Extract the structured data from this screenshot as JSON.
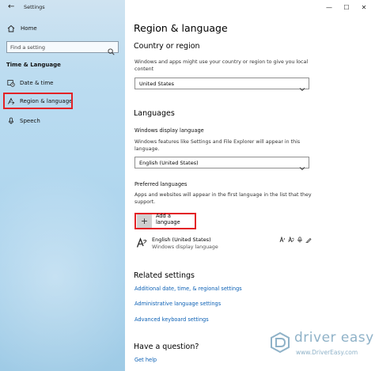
{
  "window": {
    "title": "Settings",
    "controls": {
      "minimize": "—",
      "maximize": "☐",
      "close": "✕"
    }
  },
  "sidebar": {
    "home_label": "Home",
    "search_placeholder": "Find a setting",
    "section_header": "Time & Language",
    "items": [
      {
        "label": "Date & time",
        "icon": "calendar-clock-icon"
      },
      {
        "label": "Region & language",
        "icon": "region-language-icon",
        "selected": true
      },
      {
        "label": "Speech",
        "icon": "microphone-icon"
      }
    ]
  },
  "main": {
    "page_title": "Region & language",
    "country": {
      "heading": "Country or region",
      "description": "Windows and apps might use your country or region to give you local content",
      "selected": "United States"
    },
    "languages": {
      "heading": "Languages",
      "display_label": "Windows display language",
      "display_description": "Windows features like Settings and File Explorer will appear in this language.",
      "display_selected": "English (United States)",
      "preferred_label": "Preferred languages",
      "preferred_description": "Apps and websites will appear in the first language in the list that they support.",
      "add_label": "Add a language",
      "entries": [
        {
          "name": "English (United States)",
          "sub": "Windows display language"
        }
      ]
    },
    "related": {
      "heading": "Related settings",
      "links": [
        "Additional date, time, & regional settings",
        "Administrative language settings",
        "Advanced keyboard settings"
      ]
    },
    "question": {
      "heading": "Have a question?",
      "link": "Get help"
    }
  },
  "watermark": {
    "text": "driver easy",
    "url": "www.DriverEasy.com"
  },
  "colors": {
    "highlight": "#e32226",
    "link": "#0a5fb4",
    "sidebar_tint": "#b3d8ef"
  }
}
